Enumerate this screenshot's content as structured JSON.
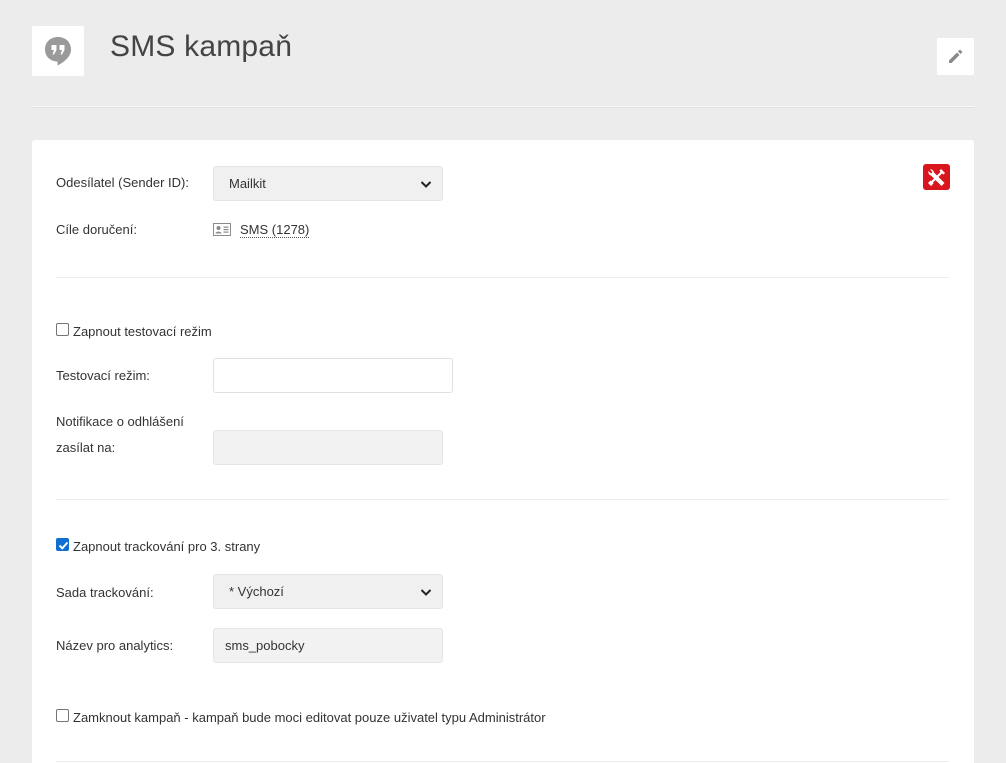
{
  "header": {
    "title": "SMS kampaň",
    "app_icon": "hangouts-quote-icon",
    "edit_icon": "pencil-icon"
  },
  "form": {
    "tools_icon": "wrench-screwdriver-icon",
    "sender_label": "Odesílatel (Sender ID):",
    "sender_value": "Mailkit",
    "targets_label": "Cíle doručení:",
    "targets_icon": "contact-card-icon",
    "targets_value": "SMS (1278)",
    "test_mode_checkbox_label": "Zapnout testovací režim",
    "test_mode_checked": false,
    "test_mode_label": "Testovací režim:",
    "test_mode_value": "",
    "unsubscribe_label_line1": "Notifikace o odhlášení",
    "unsubscribe_label_line2": "zasílat na:",
    "unsubscribe_value": "",
    "tracking_checkbox_label": "Zapnout trackování pro 3. strany",
    "tracking_checked": true,
    "tracking_set_label": "Sada trackování:",
    "tracking_set_value": "* Výchozí",
    "analytics_label": "Název pro analytics:",
    "analytics_value": "sms_pobocky",
    "lock_checkbox_label": "Zamknout kampaň - kampaň bude moci editovat pouze uživatel typu Administrátor",
    "lock_checked": false
  },
  "colors": {
    "page_bg": "#ececec",
    "accent_red": "#d9161d",
    "checkbox_blue": "#0f6fd1"
  }
}
